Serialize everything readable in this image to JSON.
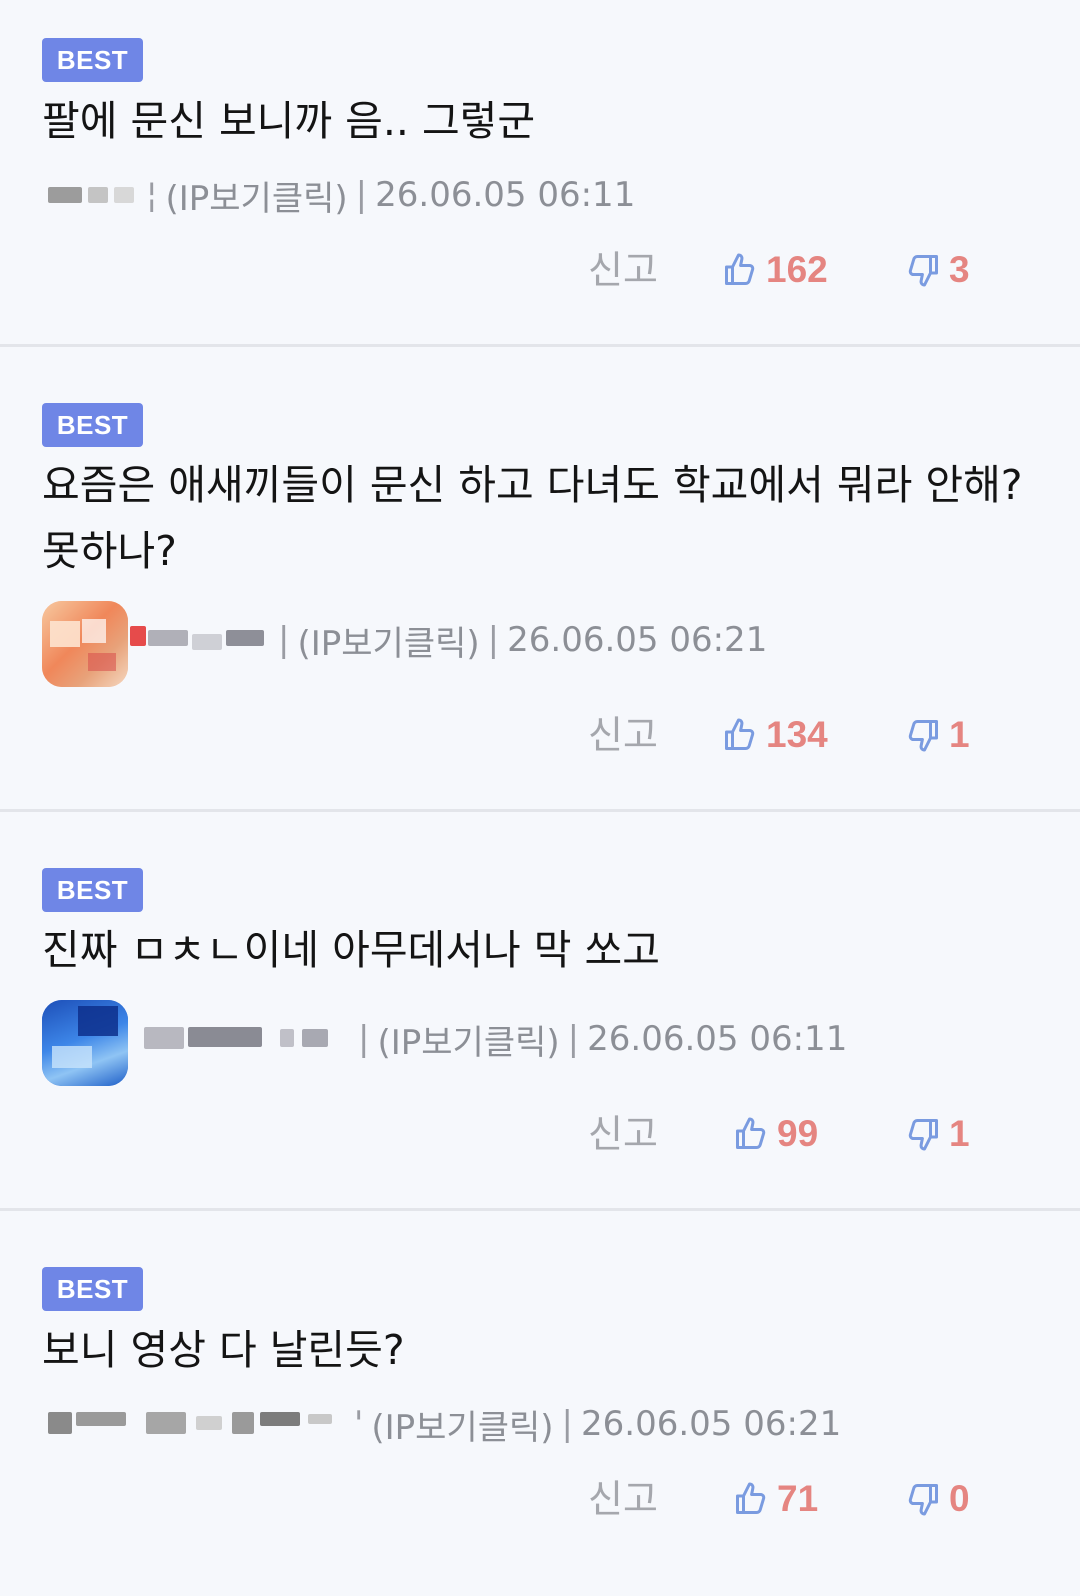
{
  "comments": [
    {
      "badge": "BEST",
      "text": "팔에 문신 보니까 음.. 그렇군",
      "ip_label": "(IP보기클릭)",
      "timestamp": "26.06.05 06:11",
      "report_label": "신고",
      "likes": "162",
      "dislikes": "3"
    },
    {
      "badge": "BEST",
      "text": "요즘은 애새끼들이 문신 하고 다녀도 학교에서 뭐라 안해? 못하나?",
      "ip_label": "(IP보기클릭)",
      "timestamp": "26.06.05 06:21",
      "report_label": "신고",
      "likes": "134",
      "dislikes": "1"
    },
    {
      "badge": "BEST",
      "text": "진짜 ㅁㅊㄴ이네 아무데서나 막 쏘고",
      "ip_label": "(IP보기클릭)",
      "timestamp": "26.06.05 06:11",
      "report_label": "신고",
      "likes": "99",
      "dislikes": "1"
    },
    {
      "badge": "BEST",
      "text": "보니 영상 다 날린듯?",
      "ip_label": "(IP보기클릭)",
      "timestamp": "26.06.05 06:21",
      "report_label": "신고",
      "likes": "71",
      "dislikes": "0"
    }
  ],
  "colors": {
    "badge": "#6f86e6",
    "vote_count": "#e58581",
    "thumb_icon": "#7a9be0",
    "meta_text": "#8c8f96",
    "divider": "#e3e5ea",
    "background": "#f6f8fc"
  },
  "icons": {
    "like": "thumbs-up-icon",
    "dislike": "thumbs-down-icon"
  }
}
